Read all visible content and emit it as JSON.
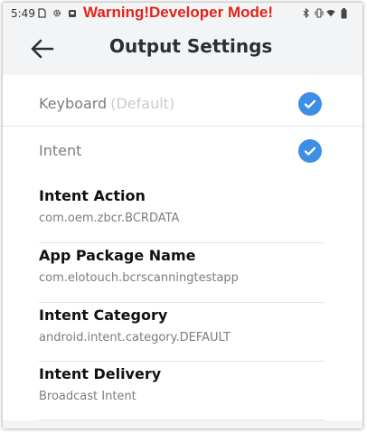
{
  "status_bar": {
    "time": "5:49",
    "warning": "Warning!Developer Mode!",
    "icons": [
      "sim-icon",
      "gear-icon",
      "android-icon",
      "bluetooth-icon",
      "vibrate-icon",
      "wifi-icon",
      "battery-icon"
    ]
  },
  "app_bar": {
    "back_icon": "arrow-left-icon",
    "title": "Output Settings"
  },
  "output_options": [
    {
      "label": "Keyboard",
      "suffix": "(Default)",
      "checked": true
    },
    {
      "label": "Intent",
      "suffix": "",
      "checked": true
    }
  ],
  "settings": [
    {
      "title": "Intent Action",
      "value": "com.oem.zbcr.BCRDATA"
    },
    {
      "title": "App Package Name",
      "value": "com.elotouch.bcrscanningtestapp"
    },
    {
      "title": "Intent Category",
      "value": "android.intent.category.DEFAULT"
    },
    {
      "title": "Intent Delivery",
      "value": "Broadcast Intent"
    }
  ],
  "colors": {
    "accent": "#3d8fe6",
    "warning": "#e2231a",
    "background": "#f3f4f6"
  }
}
